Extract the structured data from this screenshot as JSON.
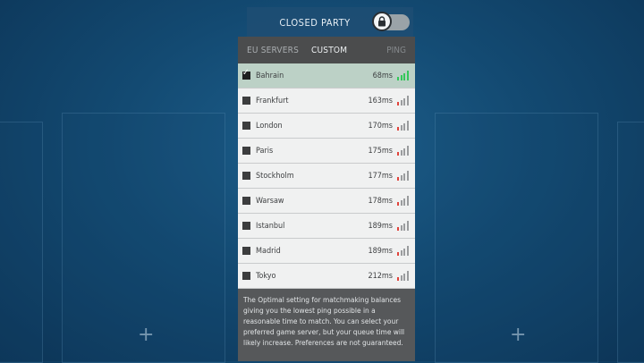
{
  "party": {
    "title": "CLOSED PARTY",
    "toggle_icon": "lock-icon"
  },
  "tabs": {
    "eu_servers": "EU SERVERS",
    "custom": "CUSTOM",
    "ping": "PING"
  },
  "servers": [
    {
      "name": "Bahrain",
      "ping": "68ms",
      "selected": true,
      "signal_color": "#34c759"
    },
    {
      "name": "Frankfurt",
      "ping": "163ms",
      "selected": false,
      "signal_color": "#e0443c"
    },
    {
      "name": "London",
      "ping": "170ms",
      "selected": false,
      "signal_color": "#e0443c"
    },
    {
      "name": "Paris",
      "ping": "175ms",
      "selected": false,
      "signal_color": "#e0443c"
    },
    {
      "name": "Stockholm",
      "ping": "177ms",
      "selected": false,
      "signal_color": "#e0443c"
    },
    {
      "name": "Warsaw",
      "ping": "178ms",
      "selected": false,
      "signal_color": "#e0443c"
    },
    {
      "name": "Istanbul",
      "ping": "189ms",
      "selected": false,
      "signal_color": "#e0443c"
    },
    {
      "name": "Madrid",
      "ping": "189ms",
      "selected": false,
      "signal_color": "#e0443c"
    },
    {
      "name": "Tokyo",
      "ping": "212ms",
      "selected": false,
      "signal_color": "#e0443c"
    }
  ],
  "info_text": "The Optimal setting for matchmaking balances giving you the lowest ping possible in a reasonable time to match. You can select your preferred game server, but your queue time will likely increase. Preferences are not guaranteed.",
  "colors": {
    "good_signal": "#34c759",
    "bad_signal": "#e0443c",
    "inactive_bar": "#9a9c9e"
  }
}
